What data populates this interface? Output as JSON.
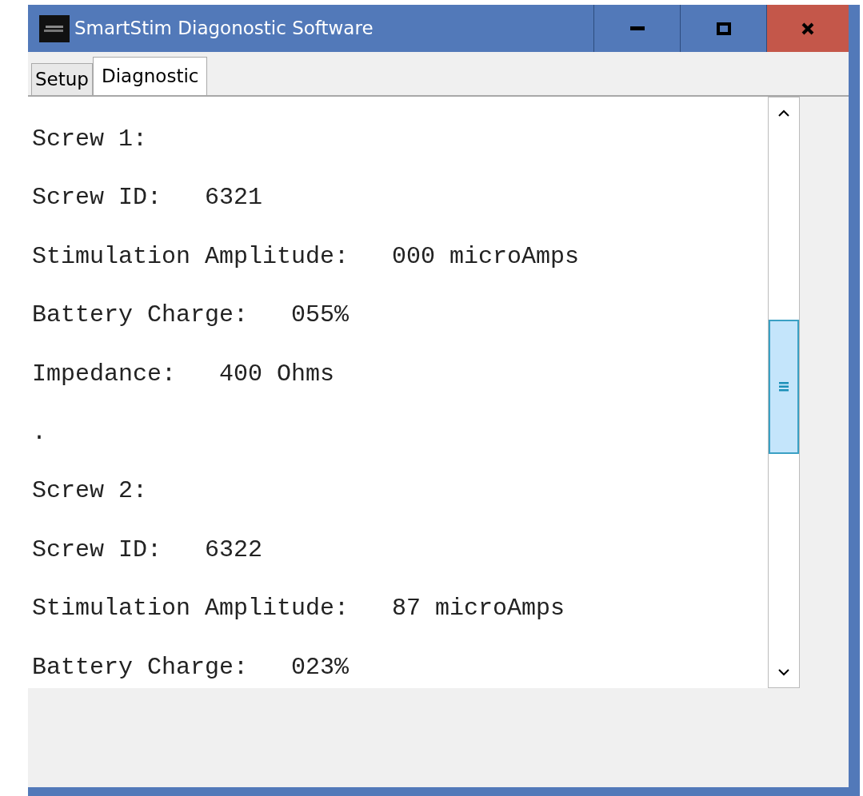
{
  "window": {
    "title": "SmartStim Diagonostic Software"
  },
  "tabs": [
    {
      "label": "Setup",
      "selected": false
    },
    {
      "label": "Diagnostic",
      "selected": true
    }
  ],
  "output": {
    "lines": [
      "Screw 1:",
      "Screw ID:   6321",
      "Stimulation Amplitude:   000 microAmps",
      "Battery Charge:   055%",
      "Impedance:   400 Ohms",
      ".",
      "Screw 2:",
      "Screw ID:   6322",
      "Stimulation Amplitude:   87 microAmps",
      "Battery Charge:   023%"
    ]
  }
}
